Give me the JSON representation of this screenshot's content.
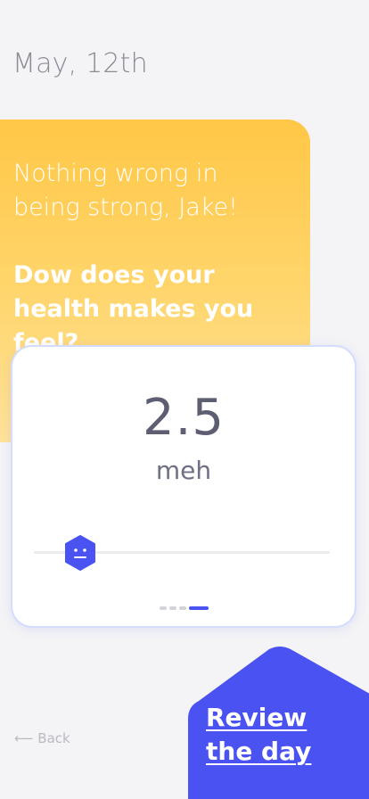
{
  "header": {
    "date": "May, 12th"
  },
  "prompt_card": {
    "greeting": "Nothing wrong in being strong, Jake!",
    "question": "Dow does your health makes you feel?"
  },
  "rating": {
    "value": "2.5",
    "label": "meh",
    "slider_level": 0.16,
    "pager": {
      "total_pages": 4,
      "active_page": 4
    }
  },
  "footer": {
    "back_label": "⟵ Back",
    "review_label": "Review the day"
  },
  "colors": {
    "accent": "#4a52f2",
    "card_gradient_top": "#ffc746",
    "card_gradient_bottom": "#ffe39a",
    "background": "#f4f4f6"
  },
  "icons": {
    "slider_thumb": "neutral-face-hexagon-icon",
    "review_button": "hexagon-shape"
  }
}
